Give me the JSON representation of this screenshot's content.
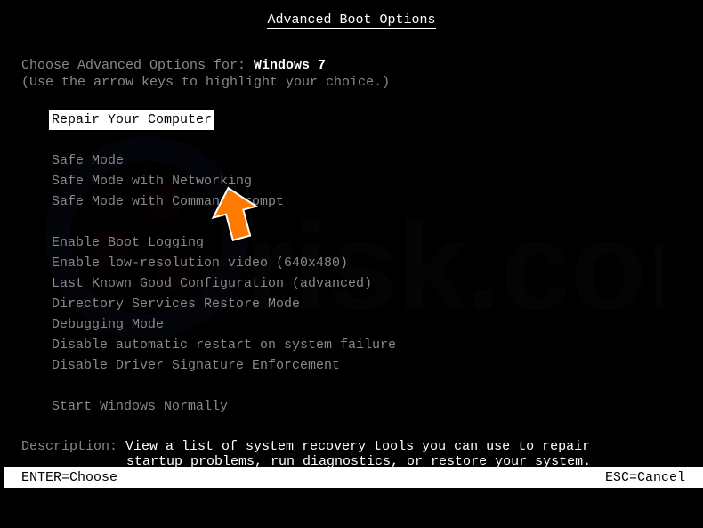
{
  "title": "Advanced Boot Options",
  "instruction_prefix": "Choose Advanced Options for: ",
  "os_name": "Windows 7",
  "instruction_hint": "(Use the arrow keys to highlight your choice.)",
  "menu": {
    "group1": [
      {
        "label": "Repair Your Computer",
        "selected": true
      }
    ],
    "group2": [
      {
        "label": "Safe Mode",
        "selected": false
      },
      {
        "label": "Safe Mode with Networking",
        "selected": false
      },
      {
        "label": "Safe Mode with Command Prompt",
        "selected": false
      }
    ],
    "group3": [
      {
        "label": "Enable Boot Logging",
        "selected": false
      },
      {
        "label": "Enable low-resolution video (640x480)",
        "selected": false
      },
      {
        "label": "Last Known Good Configuration (advanced)",
        "selected": false
      },
      {
        "label": "Directory Services Restore Mode",
        "selected": false
      },
      {
        "label": "Debugging Mode",
        "selected": false
      },
      {
        "label": "Disable automatic restart on system failure",
        "selected": false
      },
      {
        "label": "Disable Driver Signature Enforcement",
        "selected": false
      }
    ],
    "group4": [
      {
        "label": "Start Windows Normally",
        "selected": false
      }
    ]
  },
  "description": {
    "label": "Description: ",
    "line1": "View a list of system recovery tools you can use to repair",
    "line2": "startup problems, run diagnostics, or restore your system."
  },
  "footer": {
    "enter": "ENTER=Choose",
    "esc": "ESC=Cancel"
  },
  "cursor_color": "#ff7a00"
}
